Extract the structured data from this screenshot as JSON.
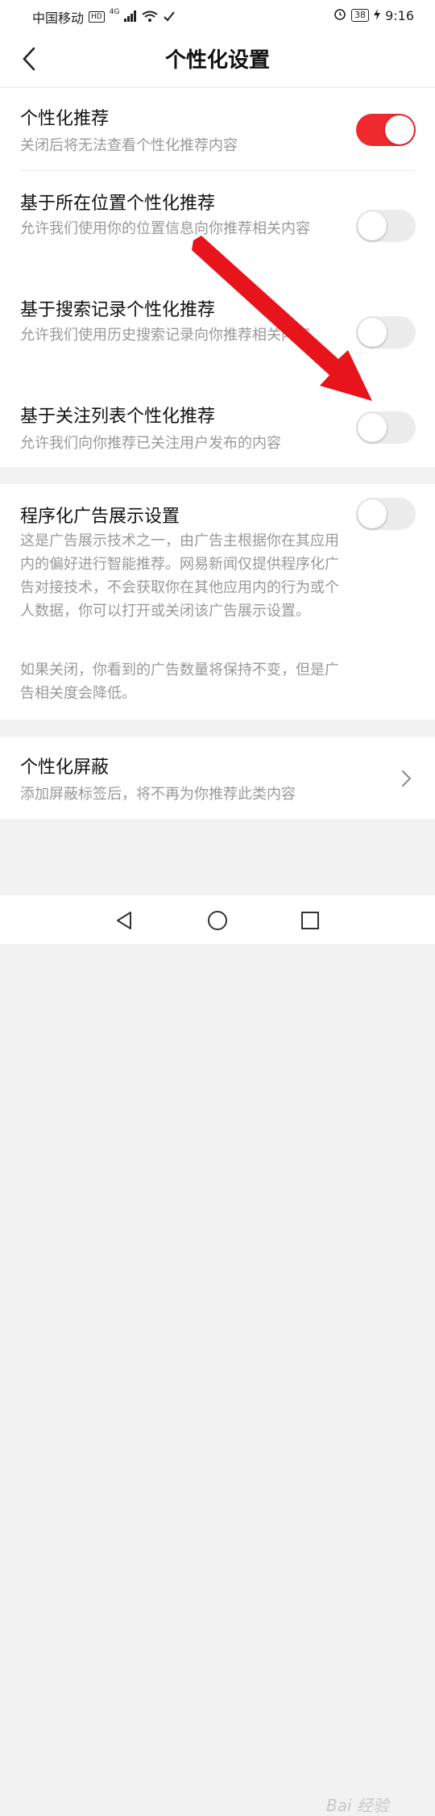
{
  "status": {
    "carrier": "中国移动",
    "hd": "HD",
    "network": "4G",
    "battery": "38",
    "time": "9:16"
  },
  "header": {
    "title": "个性化设置"
  },
  "settings": [
    {
      "title": "个性化推荐",
      "desc": "关闭后将无法查看个性化推荐内容",
      "on": true
    },
    {
      "title": "基于所在位置个性化推荐",
      "desc": "允许我们使用你的位置信息向你推荐相关内容",
      "on": false
    },
    {
      "title": "基于搜索记录个性化推荐",
      "desc": "允许我们使用历史搜索记录向你推荐相关内容",
      "on": false
    },
    {
      "title": "基于关注列表个性化推荐",
      "desc": "允许我们向你推荐已关注用户发布的内容",
      "on": false
    }
  ],
  "ad": {
    "title": "程序化广告展示设置",
    "on": false,
    "desc1": "这是广告展示技术之一，由广告主根据你在其应用内的偏好进行智能推荐。网易新闻仅提供程序化广告对接技术，不会获取你在其他应用内的行为或个人数据，你可以打开或关闭该广告展示设置。",
    "desc2": "如果关闭，你看到的广告数量将保持不变，但是广告相关度会降低。"
  },
  "block": {
    "title": "个性化屏蔽",
    "desc": "添加屏蔽标签后，将不再为你推荐此类内容"
  },
  "watermark": "Bai 经验",
  "colors": {
    "accent": "#ee2a2f",
    "arrow": "#e8141c"
  }
}
